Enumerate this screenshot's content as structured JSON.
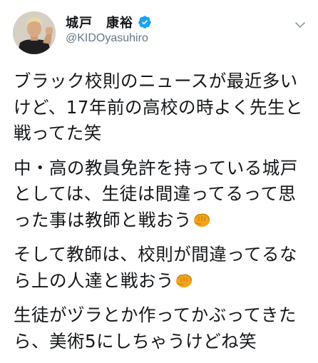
{
  "author": {
    "display_name": "城戸　康裕",
    "handle": "@KIDOyasuhiro",
    "verified": true,
    "avatar_icon": "profile-photo"
  },
  "menu": {
    "icon": "chevron-down-icon"
  },
  "tweet": {
    "paragraphs": [
      {
        "text": "ブラック校則のニュースが最近多いけど、17年前の高校の時よく先生と戦ってた笑",
        "emoji": ""
      },
      {
        "text": "中・高の教員免許を持っている城戸としては、生徒は間違ってるって思った事は教師と戦おう",
        "emoji": "oncoming-fist-emoji"
      },
      {
        "text": "そして教師は、校則が間違ってるなら上の人達と戦おう",
        "emoji": "oncoming-fist-emoji"
      },
      {
        "text": "生徒がヅラとか作ってかぶってきたら、美術5にしちゃうけどね笑",
        "emoji": ""
      }
    ]
  },
  "colors": {
    "text": "#14171a",
    "secondary": "#657786",
    "verified_blue": "#1da1f2",
    "fist": "#f4a51c"
  }
}
